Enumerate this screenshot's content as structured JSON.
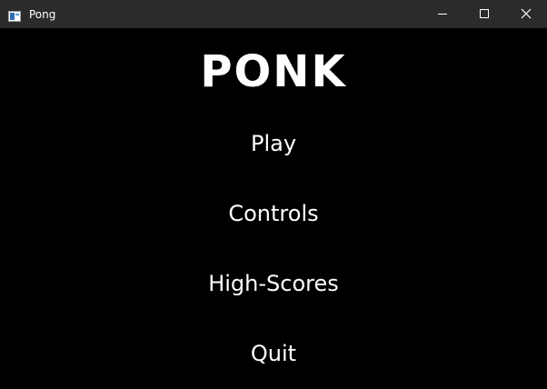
{
  "window": {
    "title": "Pong",
    "controls": {
      "minimize_icon": "minimize-icon",
      "maximize_icon": "maximize-icon",
      "close_icon": "close-icon"
    }
  },
  "game": {
    "title": "PONK",
    "menu": [
      {
        "label": "Play"
      },
      {
        "label": "Controls"
      },
      {
        "label": "High-Scores"
      },
      {
        "label": "Quit"
      }
    ]
  },
  "colors": {
    "background": "#000000",
    "titlebar": "#2b2b2b",
    "text": "#ffffff"
  }
}
